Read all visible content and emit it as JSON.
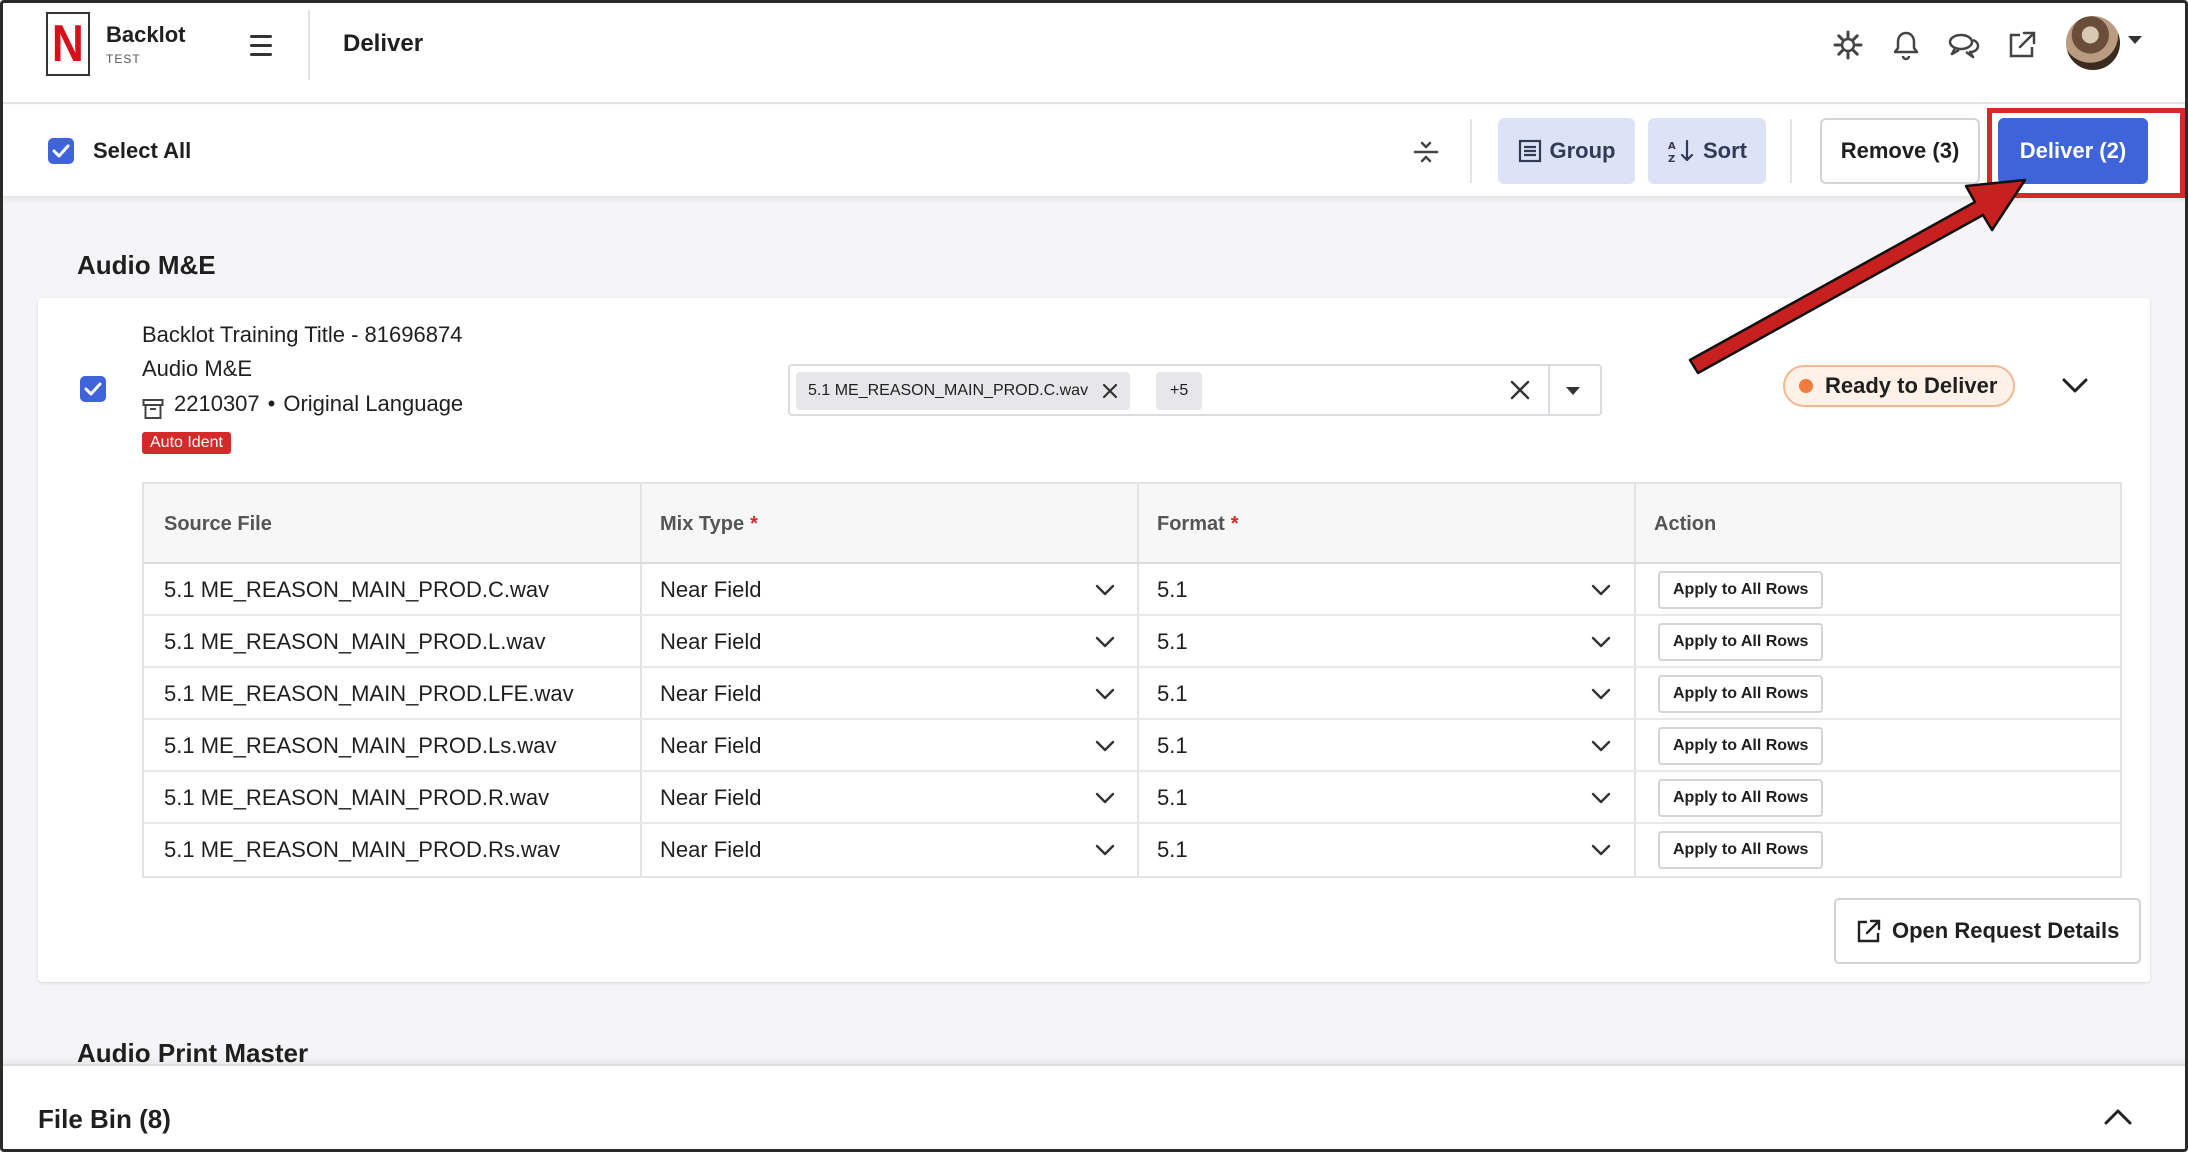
{
  "header": {
    "brand_name": "Backlot",
    "brand_env": "TEST",
    "logo_letter": "N",
    "page_title": "Deliver",
    "icons": [
      "gear-icon",
      "bell-icon",
      "chat-icon",
      "external-link-icon"
    ]
  },
  "toolbar": {
    "select_all_label": "Select All",
    "select_all_checked": true,
    "group_label": "Group",
    "sort_label": "Sort",
    "remove_label": "Remove (3)",
    "deliver_label": "Deliver (2)"
  },
  "groups": [
    {
      "title": "Audio M&E",
      "card": {
        "checked": true,
        "title": "Backlot Training Title - 81696874",
        "subtitle": "Audio M&E",
        "request_id": "2210307",
        "language": "Original Language",
        "separator": "•",
        "badge": "Auto Ident",
        "selected_file_chip": "5.1 ME_REASON_MAIN_PROD.C.wav",
        "more_chip": "+5",
        "status": "Ready to Deliver",
        "columns": [
          "Source File",
          "Mix Type",
          "Format",
          "Action"
        ],
        "required_marker": "*",
        "rows": [
          {
            "source": "5.1 ME_REASON_MAIN_PROD.C.wav",
            "mix": "Near Field",
            "format": "5.1",
            "action": "Apply to All Rows"
          },
          {
            "source": "5.1 ME_REASON_MAIN_PROD.L.wav",
            "mix": "Near Field",
            "format": "5.1",
            "action": "Apply to All Rows"
          },
          {
            "source": "5.1 ME_REASON_MAIN_PROD.LFE.wav",
            "mix": "Near Field",
            "format": "5.1",
            "action": "Apply to All Rows"
          },
          {
            "source": "5.1 ME_REASON_MAIN_PROD.Ls.wav",
            "mix": "Near Field",
            "format": "5.1",
            "action": "Apply to All Rows"
          },
          {
            "source": "5.1 ME_REASON_MAIN_PROD.R.wav",
            "mix": "Near Field",
            "format": "5.1",
            "action": "Apply to All Rows"
          },
          {
            "source": "5.1 ME_REASON_MAIN_PROD.Rs.wav",
            "mix": "Near Field",
            "format": "5.1",
            "action": "Apply to All Rows"
          }
        ],
        "open_request_label": "Open Request Details"
      }
    },
    {
      "title": "Audio Print Master"
    }
  ],
  "file_bin": {
    "label": "File Bin (8)"
  },
  "colors": {
    "primary": "#3f63d9",
    "soft_button": "#dde3f7",
    "status_dot": "#f07b3f",
    "badge_red": "#d42a2a",
    "annotation_red": "#d42a2a"
  }
}
